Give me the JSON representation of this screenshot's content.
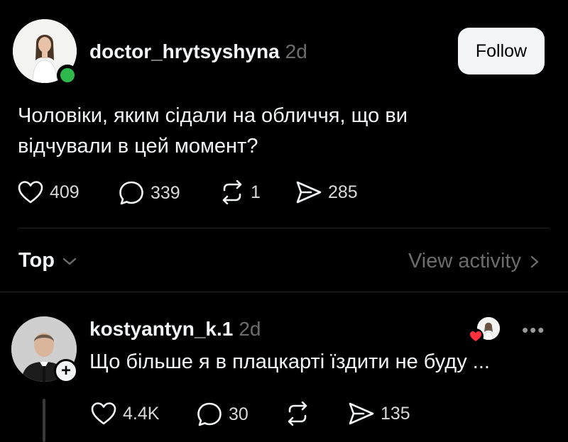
{
  "post": {
    "username": "doctor_hrytsyshyna",
    "time": "2d",
    "follow_label": "Follow",
    "text_line1": "Чоловіки, яким сідали на обличчя, що ви",
    "text_line2": "відчували в цей момент?",
    "likes": "409",
    "comments": "339",
    "reposts": "1",
    "shares": "285"
  },
  "sort": {
    "label": "Top",
    "view_activity_label": "View activity"
  },
  "reply": {
    "username": "kostyantyn_k.1",
    "time": "2d",
    "text": "Що більше я в плацкарті їздити не буду ...",
    "likes": "4.4K",
    "comments": "30",
    "reposts": "",
    "shares": "135"
  },
  "icons": {
    "like": "heart-icon",
    "comment": "comment-icon",
    "repost": "repost-icon",
    "share": "send-icon",
    "more": "more-icon",
    "chevron": "chevron-down-icon"
  },
  "colors": {
    "background": "#000000",
    "text": "#f3f5f7",
    "muted": "#6c6c6c",
    "online": "#2fb84b",
    "heart_badge": "#ff3040"
  }
}
